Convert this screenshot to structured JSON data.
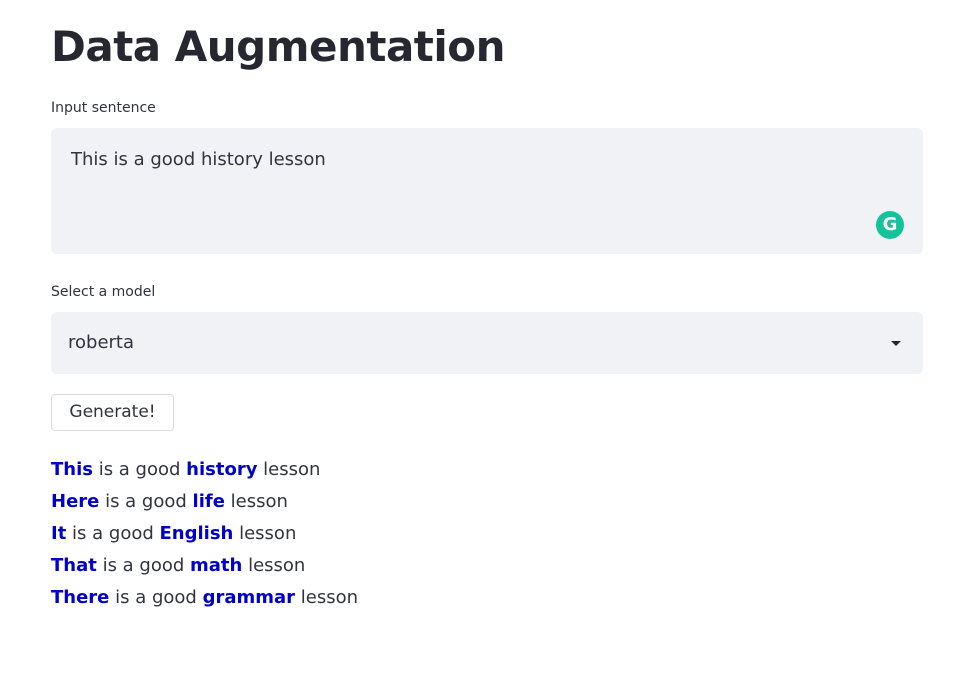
{
  "page": {
    "title": "Data Augmentation"
  },
  "input": {
    "label": "Input sentence",
    "value": "This is a good history lesson",
    "extension_icon": "grammarly-icon",
    "extension_glyph": "G"
  },
  "model_select": {
    "label": "Select a model",
    "selected": "roberta",
    "caret_icon": "caret-down-icon"
  },
  "generate_button": {
    "label": "Generate!"
  },
  "results": [
    {
      "first": "This",
      "mid": " is a good ",
      "second": "history",
      "end": " lesson"
    },
    {
      "first": "Here",
      "mid": " is a good ",
      "second": "life",
      "end": " lesson"
    },
    {
      "first": "It",
      "mid": " is a good ",
      "second": "English",
      "end": " lesson"
    },
    {
      "first": "That",
      "mid": " is a good ",
      "second": "math",
      "end": " lesson"
    },
    {
      "first": "There",
      "mid": " is a good ",
      "second": "grammar",
      "end": " lesson"
    }
  ],
  "colors": {
    "highlight": "#0000cc",
    "field_bg": "#f0f2f6",
    "grammarly": "#15c39a"
  }
}
